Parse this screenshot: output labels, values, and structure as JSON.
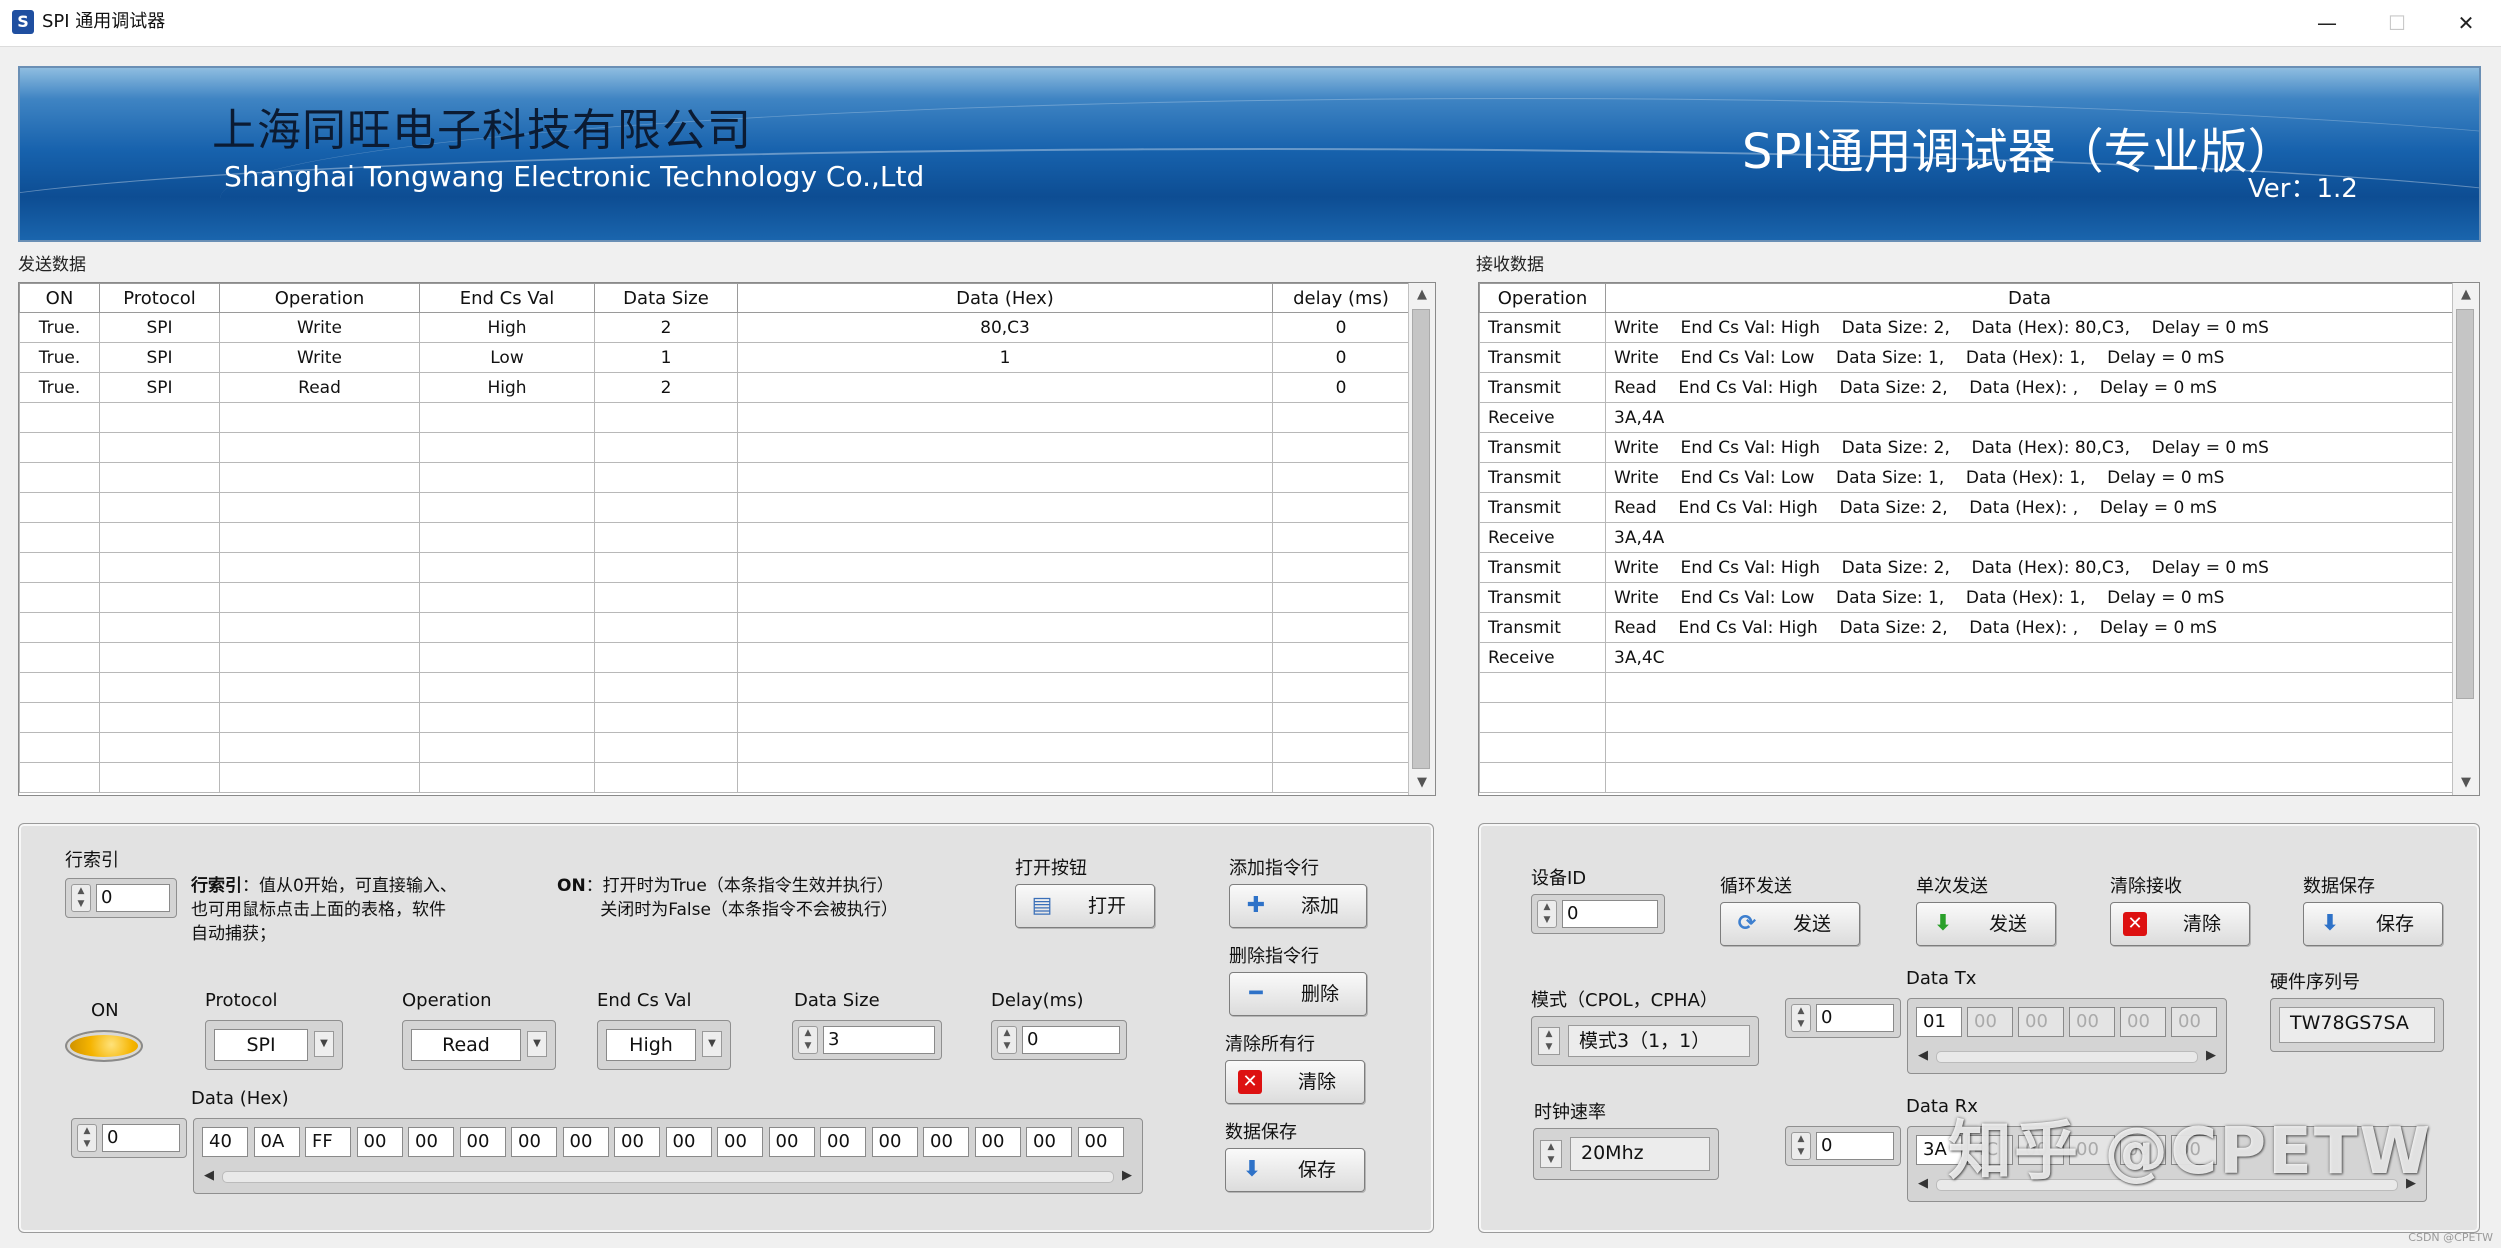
{
  "window": {
    "title": "SPI 通用调试器",
    "minimize": "—",
    "maximize": "☐",
    "close": "✕"
  },
  "banner": {
    "company_cn": "上海同旺电子科技有限公司",
    "company_en": "Shanghai Tongwang Electronic Technology Co.,Ltd",
    "product": "SPI通用调试器（专业版）",
    "version": "Ver：1.2"
  },
  "send": {
    "section_label": "发送数据",
    "columns": [
      "ON",
      "Protocol",
      "Operation",
      "End Cs Val",
      "Data Size",
      "Data (Hex)",
      "delay (ms)"
    ],
    "rows": [
      [
        "True.",
        "SPI",
        "Write",
        "High",
        "2",
        "80,C3",
        "0"
      ],
      [
        "True.",
        "SPI",
        "Write",
        "Low",
        "1",
        "1",
        "0"
      ],
      [
        "True.",
        "SPI",
        "Read",
        "High",
        "2",
        "",
        "0"
      ]
    ]
  },
  "receive": {
    "section_label": "接收数据",
    "columns": [
      "Operation",
      "Data"
    ],
    "rows": [
      [
        "Transmit",
        "Write    End Cs Val: High    Data Size: 2,    Data (Hex): 80,C3,    Delay = 0 mS"
      ],
      [
        "Transmit",
        "Write    End Cs Val: Low    Data Size: 1,    Data (Hex): 1,    Delay = 0 mS"
      ],
      [
        "Transmit",
        "Read    End Cs Val: High    Data Size: 2,    Data (Hex): ,    Delay = 0 mS"
      ],
      [
        "Receive",
        "3A,4A"
      ],
      [
        "Transmit",
        "Write    End Cs Val: High    Data Size: 2,    Data (Hex): 80,C3,    Delay = 0 mS"
      ],
      [
        "Transmit",
        "Write    End Cs Val: Low    Data Size: 1,    Data (Hex): 1,    Delay = 0 mS"
      ],
      [
        "Transmit",
        "Read    End Cs Val: High    Data Size: 2,    Data (Hex): ,    Delay = 0 mS"
      ],
      [
        "Receive",
        "3A,4A"
      ],
      [
        "Transmit",
        "Write    End Cs Val: High    Data Size: 2,    Data (Hex): 80,C3,    Delay = 0 mS"
      ],
      [
        "Transmit",
        "Write    End Cs Val: Low    Data Size: 1,    Data (Hex): 1,    Delay = 0 mS"
      ],
      [
        "Transmit",
        "Read    End Cs Val: High    Data Size: 2,    Data (Hex): ,    Delay = 0 mS"
      ],
      [
        "Receive",
        "3A,4C"
      ]
    ]
  },
  "left_panel": {
    "row_index_label": "行索引",
    "row_index_value": "0",
    "row_index_note_title": "行索引",
    "row_index_note": "：值从0开始，可直接输入、\n也可用鼠标点击上面的表格，软件\n自动捕获；",
    "on_note_title": "ON",
    "on_note": "：打开时为True（本条指令生效并执行）\n        关闭时为False（本条指令不会被执行）",
    "open_label": "打开按钮",
    "open_button": "打开",
    "add_label": "添加指令行",
    "add_button": "添加",
    "delete_label": "删除指令行",
    "delete_button": "删除",
    "clear_label": "清除所有行",
    "clear_button": "清除",
    "save_label": "数据保存",
    "save_button": "保存",
    "on_label": "ON",
    "protocol_label": "Protocol",
    "protocol_value": "SPI",
    "operation_label": "Operation",
    "operation_value": "Read",
    "endcs_label": "End Cs Val",
    "endcs_value": "High",
    "datasize_label": "Data Size",
    "datasize_value": "3",
    "delay_label": "Delay(ms)",
    "delay_value": "0",
    "data_hex_label": "Data (Hex)",
    "data_hex_index": "0",
    "data_hex_cells": [
      "40",
      "0A",
      "FF",
      "00",
      "00",
      "00",
      "00",
      "00",
      "00",
      "00",
      "00",
      "00",
      "00",
      "00",
      "00",
      "00",
      "00",
      "00"
    ]
  },
  "right_panel": {
    "device_id_label": "设备ID",
    "device_id_value": "0",
    "loop_send_label": "循环发送",
    "loop_send_button": "发送",
    "single_send_label": "单次发送",
    "single_send_button": "发送",
    "clear_recv_label": "清除接收",
    "clear_recv_button": "清除",
    "save_label": "数据保存",
    "save_button": "保存",
    "mode_label": "模式（CPOL，CPHA）",
    "mode_value": "模式3（1，1）",
    "data_tx_label": "Data Tx",
    "data_tx_index": "0",
    "data_tx_cells": [
      "01",
      "00",
      "00",
      "00",
      "00",
      "00"
    ],
    "serial_label": "硬件序列号",
    "serial_value": "TW78GS7SA",
    "clock_label": "时钟速率",
    "clock_value": "20Mhz",
    "data_rx_label": "Data Rx",
    "data_rx_index": "0",
    "data_rx_cells": [
      "3A",
      "4C",
      "00",
      "00",
      "00",
      "00"
    ]
  },
  "watermark": "知乎 @CPETW",
  "corner_text": "CSDN @CPETW"
}
